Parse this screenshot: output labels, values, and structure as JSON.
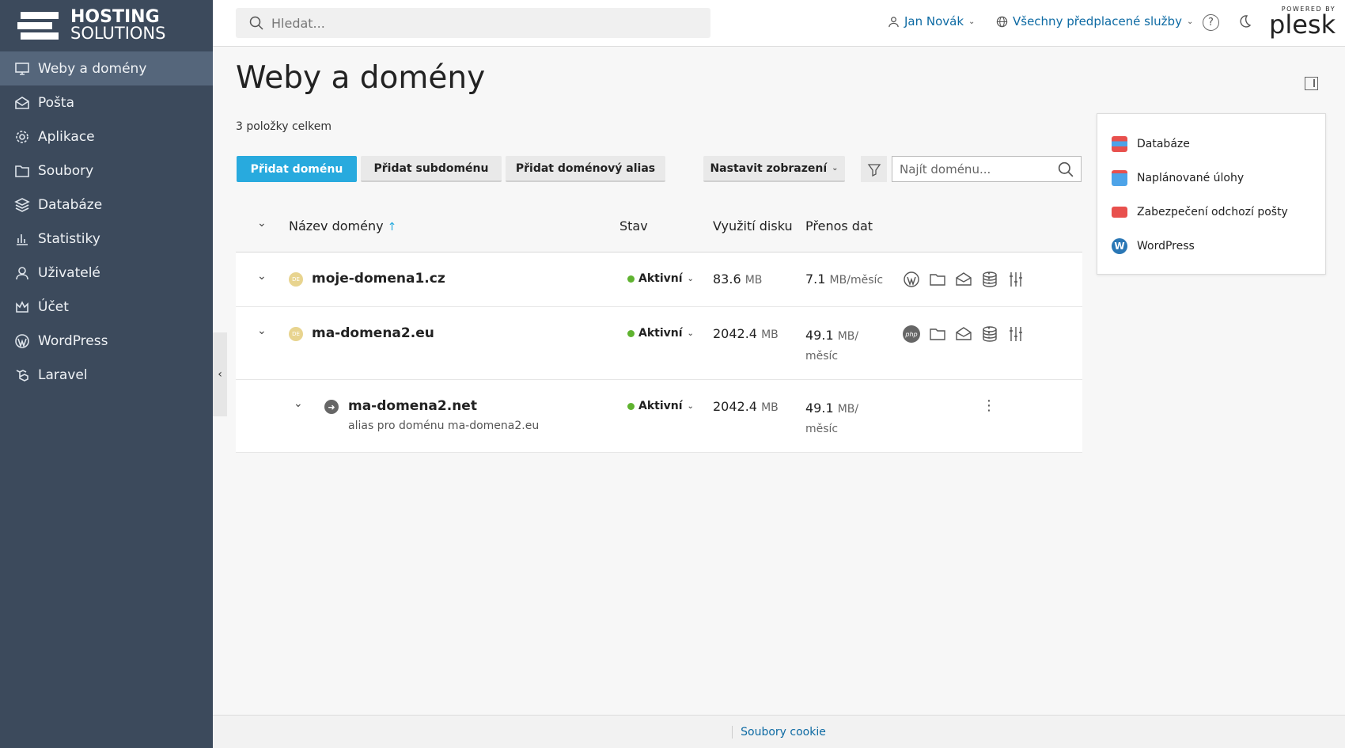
{
  "brand": {
    "line1": "HOSTING",
    "line2": "SOLUTIONS"
  },
  "sidebar": {
    "items": [
      {
        "label": "Weby a domény",
        "icon": "monitor-icon",
        "active": true
      },
      {
        "label": "Pošta",
        "icon": "mail-icon"
      },
      {
        "label": "Aplikace",
        "icon": "gear-icon"
      },
      {
        "label": "Soubory",
        "icon": "folder-icon"
      },
      {
        "label": "Databáze",
        "icon": "layers-icon"
      },
      {
        "label": "Statistiky",
        "icon": "bar-chart-icon"
      },
      {
        "label": "Uživatelé",
        "icon": "user-icon"
      },
      {
        "label": "Účet",
        "icon": "crown-icon"
      },
      {
        "label": "WordPress",
        "icon": "wordpress-icon"
      },
      {
        "label": "Laravel",
        "icon": "laravel-icon"
      }
    ]
  },
  "topbar": {
    "search_placeholder": "Hledat...",
    "user_name": "Jan Novák",
    "subscriptions": "Všechny předplacené služby",
    "help": "?",
    "powered_by": "POWERED BY",
    "plesk": "plesk"
  },
  "main": {
    "title": "Weby a domény",
    "count": "3 položky celkem",
    "buttons": {
      "add_domain": "Přidat doménu",
      "add_subdomain": "Přidat subdoménu",
      "add_alias": "Přidat doménový alias",
      "view_settings": "Nastavit zobrazení"
    },
    "find_placeholder": "Najít doménu...",
    "columns": {
      "name": "Název domény",
      "status": "Stav",
      "disk": "Využití disku",
      "traffic": "Přenos dat"
    },
    "rows": [
      {
        "name": "moje-domena1.cz",
        "favicon": "DE",
        "status": "Aktivní",
        "disk": "83.6",
        "disk_unit": "MB",
        "traffic": "7.1",
        "traffic_unit": "MB/měsíc"
      },
      {
        "name": "ma-domena2.eu",
        "favicon": "DE",
        "status": "Aktivní",
        "disk": "2042.4",
        "disk_unit": "MB",
        "traffic": "49.1",
        "traffic_unit_1": "MB/",
        "traffic_unit_2": "měsíc"
      },
      {
        "name": "ma-domena2.net",
        "alias_note": "alias pro doménu ma-domena2.eu",
        "status": "Aktivní",
        "disk": "2042.4",
        "disk_unit": "MB",
        "traffic": "49.1",
        "traffic_unit_1": "MB/",
        "traffic_unit_2": "měsíc"
      }
    ]
  },
  "side_panel": {
    "items": [
      {
        "label": "Databáze",
        "color": "#e8504d"
      },
      {
        "label": "Naplánované úlohy",
        "color": "#4da3e8"
      },
      {
        "label": "Zabezpečení odchozí pošty",
        "color": "#e8504d"
      },
      {
        "label": "WordPress",
        "color": "#2a77b5"
      }
    ]
  },
  "footer": {
    "cookies": "Soubory cookie"
  },
  "colors": {
    "sidebar": "#3c4a5c",
    "sidebar_active": "#55667b",
    "primary": "#28aade",
    "link": "#0d6aa3",
    "active_dot": "#5fb330"
  }
}
